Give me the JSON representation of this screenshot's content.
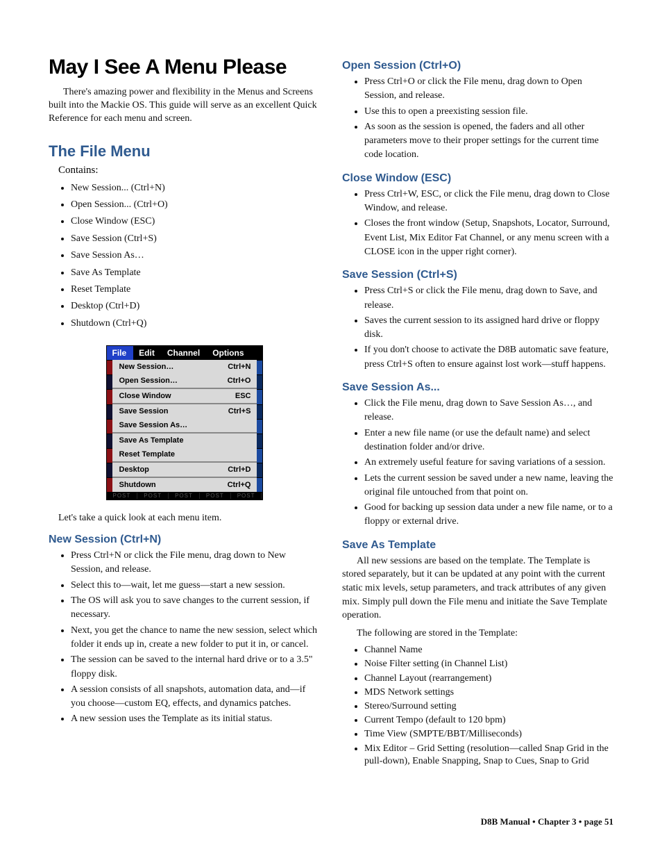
{
  "title": "May I See A Menu Please",
  "intro": "There's amazing power and flexibility in the Menus and Screens built into the Mackie OS. This guide will serve as an excellent Quick Reference for each menu and screen.",
  "fileMenu": {
    "heading": "The File Menu",
    "containsLabel": "Contains:",
    "contains": [
      "New Session... (Ctrl+N)",
      "Open Session... (Ctrl+O)",
      "Close Window (ESC)",
      "Save Session (Ctrl+S)",
      "Save Session As…",
      "Save As Template",
      "Reset Template",
      "Desktop (Ctrl+D)",
      "Shutdown (Ctrl+Q)"
    ]
  },
  "menuShot": {
    "menubar": [
      "File",
      "Edit",
      "Channel",
      "Options"
    ],
    "groups": [
      [
        {
          "label": "New Session…",
          "shortcut": "Ctrl+N"
        },
        {
          "label": "Open Session…",
          "shortcut": "Ctrl+O"
        }
      ],
      [
        {
          "label": "Close Window",
          "shortcut": "ESC"
        }
      ],
      [
        {
          "label": "Save Session",
          "shortcut": "Ctrl+S"
        },
        {
          "label": "Save Session As…",
          "shortcut": ""
        }
      ],
      [
        {
          "label": "Save As Template",
          "shortcut": ""
        },
        {
          "label": "Reset Template",
          "shortcut": ""
        }
      ],
      [
        {
          "label": "Desktop",
          "shortcut": "Ctrl+D"
        }
      ],
      [
        {
          "label": "Shutdown",
          "shortcut": "Ctrl+Q"
        }
      ]
    ],
    "postLabel": "POST"
  },
  "lead": "Let's take a quick look at each menu item.",
  "sections": {
    "newSession": {
      "heading": "New Session (Ctrl+N)",
      "items": [
        "Press Ctrl+N or click the File menu, drag down to New Session, and release.",
        "Select this to—wait, let me guess—start a new session.",
        "The OS will ask you to save changes to the current session, if necessary.",
        "Next, you get the chance to name the new session, select which folder it ends up in, create a new folder to put it in, or cancel.",
        "The session can be saved to the internal hard drive or to a 3.5\" floppy disk.",
        "A session consists of all snapshots, automation data, and—if you choose—custom EQ, effects, and dynamics patches.",
        "A new session uses the Template as its initial status."
      ]
    },
    "openSession": {
      "heading": "Open Session (Ctrl+O)",
      "items": [
        "Press Ctrl+O or click the File menu, drag down to Open Session, and release.",
        "Use this to open a preexisting session file.",
        "As soon as the session is opened, the faders and all other parameters move to their proper settings for the current time code location."
      ]
    },
    "closeWindow": {
      "heading": "Close Window (ESC)",
      "items": [
        "Press Ctrl+W, ESC, or click the File menu, drag down to Close Window, and release.",
        "Closes the front window (Setup, Snapshots, Locator, Surround, Event List, Mix Editor Fat Channel, or any menu screen with a CLOSE icon in the upper right corner)."
      ]
    },
    "saveSession": {
      "heading": "Save Session (Ctrl+S)",
      "items": [
        "Press Ctrl+S or click the File menu, drag down to Save, and release.",
        "Saves the current session to its assigned hard drive or floppy disk.",
        "If you don't choose to activate the D8B automatic save feature, press Ctrl+S often to ensure against lost work—stuff happens."
      ]
    },
    "saveSessionAs": {
      "heading": "Save Session As...",
      "items": [
        "Click the File menu, drag down to Save Session As…, and release.",
        "Enter a new file name (or use the default name) and select destination folder and/or drive.",
        "An extremely useful feature for saving variations of a session.",
        "Lets the current session be saved under a new name, leaving the original file untouched from that point on.",
        "Good for backing up session data under a new file name, or to a floppy or external drive."
      ]
    },
    "saveAsTemplate": {
      "heading": "Save As Template",
      "para1": "All new sessions are based on the template. The Template is stored separately, but it can be updated at any point with the current static mix levels, setup parameters, and track attributes of any given mix. Simply pull down the File menu and initiate the Save Template operation.",
      "para2": "The following are stored in the Template:",
      "items": [
        "Channel Name",
        "Noise Filter setting (in Channel List)",
        "Channel Layout (rearrangement)",
        "MDS Network settings",
        "Stereo/Surround setting",
        "Current Tempo (default to 120 bpm)",
        "Time View (SMPTE/BBT/Milliseconds)",
        "Mix Editor – Grid Setting (resolution—called Snap Grid in the pull-down), Enable Snapping, Snap to Cues, Snap to Grid"
      ]
    }
  },
  "footer": "D8B Manual • Chapter 3 • page  51"
}
